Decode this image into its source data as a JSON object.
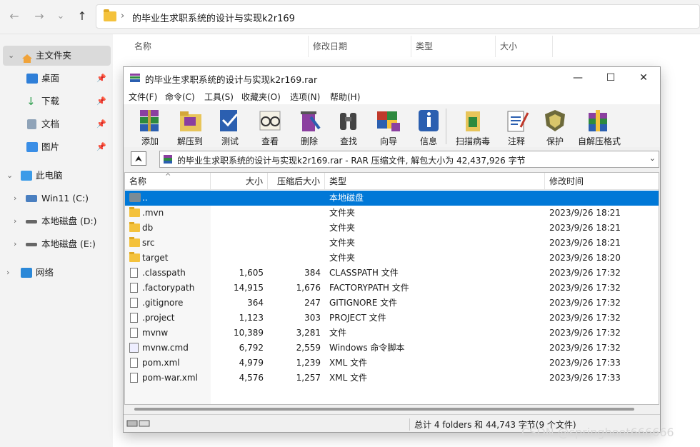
{
  "explorer": {
    "address_path": "的毕业生求职系统的设计与实现k2r169",
    "nav": {
      "back": "←",
      "forward": "→",
      "recent": "⌄",
      "up": "↑"
    },
    "sidebar": [
      {
        "label": "主文件夹",
        "icon": "home-icon",
        "selected": true
      },
      {
        "label": "桌面",
        "icon": "desktop-icon",
        "pinned": true
      },
      {
        "label": "下载",
        "icon": "download-icon",
        "pinned": true
      },
      {
        "label": "文档",
        "icon": "documents-icon",
        "pinned": true
      },
      {
        "label": "图片",
        "icon": "pictures-icon",
        "pinned": true
      },
      {
        "label": "此电脑",
        "icon": "this-pc-icon"
      },
      {
        "label": "Win11 (C:)",
        "icon": "drive-c-icon"
      },
      {
        "label": "本地磁盘 (D:)",
        "icon": "drive-d-icon"
      },
      {
        "label": "本地磁盘 (E:)",
        "icon": "drive-e-icon"
      },
      {
        "label": "网络",
        "icon": "network-icon"
      }
    ],
    "columns": [
      "名称",
      "修改日期",
      "类型",
      "大小"
    ]
  },
  "rar": {
    "title": "的毕业生求职系统的设计与实现k2r169.rar",
    "window_buttons": {
      "minimize": "—",
      "maximize": "☐",
      "close": "✕"
    },
    "menu": [
      "文件(F)",
      "命令(C)",
      "工具(S)",
      "收藏夹(O)",
      "选项(N)",
      "帮助(H)"
    ],
    "toolbar": [
      "添加",
      "解压到",
      "测试",
      "查看",
      "删除",
      "查找",
      "向导",
      "信息",
      "扫描病毒",
      "注释",
      "保护",
      "自解压格式"
    ],
    "path_text": "的毕业生求职系统的设计与实现k2r169.rar - RAR 压缩文件, 解包大小为 42,437,926 字节",
    "up_button": "⮝",
    "headers": {
      "name": "名称",
      "size": "大小",
      "packed": "压缩后大小",
      "type": "类型",
      "modified": "修改时间"
    },
    "rows": [
      {
        "name": "..",
        "size": "",
        "packed": "",
        "type": "本地磁盘",
        "modified": "",
        "kind": "up",
        "selected": true
      },
      {
        "name": ".mvn",
        "size": "",
        "packed": "",
        "type": "文件夹",
        "modified": "2023/9/26 18:21",
        "kind": "folder"
      },
      {
        "name": "db",
        "size": "",
        "packed": "",
        "type": "文件夹",
        "modified": "2023/9/26 18:21",
        "kind": "folder"
      },
      {
        "name": "src",
        "size": "",
        "packed": "",
        "type": "文件夹",
        "modified": "2023/9/26 18:21",
        "kind": "folder"
      },
      {
        "name": "target",
        "size": "",
        "packed": "",
        "type": "文件夹",
        "modified": "2023/9/26 18:20",
        "kind": "folder"
      },
      {
        "name": ".classpath",
        "size": "1,605",
        "packed": "384",
        "type": "CLASSPATH 文件",
        "modified": "2023/9/26 17:32",
        "kind": "file"
      },
      {
        "name": ".factorypath",
        "size": "14,915",
        "packed": "1,676",
        "type": "FACTORYPATH 文件",
        "modified": "2023/9/26 17:32",
        "kind": "file"
      },
      {
        "name": ".gitignore",
        "size": "364",
        "packed": "247",
        "type": "GITIGNORE 文件",
        "modified": "2023/9/26 17:32",
        "kind": "file"
      },
      {
        "name": ".project",
        "size": "1,123",
        "packed": "303",
        "type": "PROJECT 文件",
        "modified": "2023/9/26 17:32",
        "kind": "file"
      },
      {
        "name": "mvnw",
        "size": "10,389",
        "packed": "3,281",
        "type": "文件",
        "modified": "2023/9/26 17:32",
        "kind": "file"
      },
      {
        "name": "mvnw.cmd",
        "size": "6,792",
        "packed": "2,559",
        "type": "Windows 命令脚本",
        "modified": "2023/9/26 17:32",
        "kind": "cmd"
      },
      {
        "name": "pom.xml",
        "size": "4,979",
        "packed": "1,239",
        "type": "XML 文件",
        "modified": "2023/9/26 17:33",
        "kind": "file"
      },
      {
        "name": "pom-war.xml",
        "size": "4,576",
        "packed": "1,257",
        "type": "XML 文件",
        "modified": "2023/9/26 17:33",
        "kind": "file"
      }
    ],
    "status_text": "总计 4 folders 和 44,743 字节(9 个文件)"
  },
  "watermark": "CSDN @springboot666666"
}
